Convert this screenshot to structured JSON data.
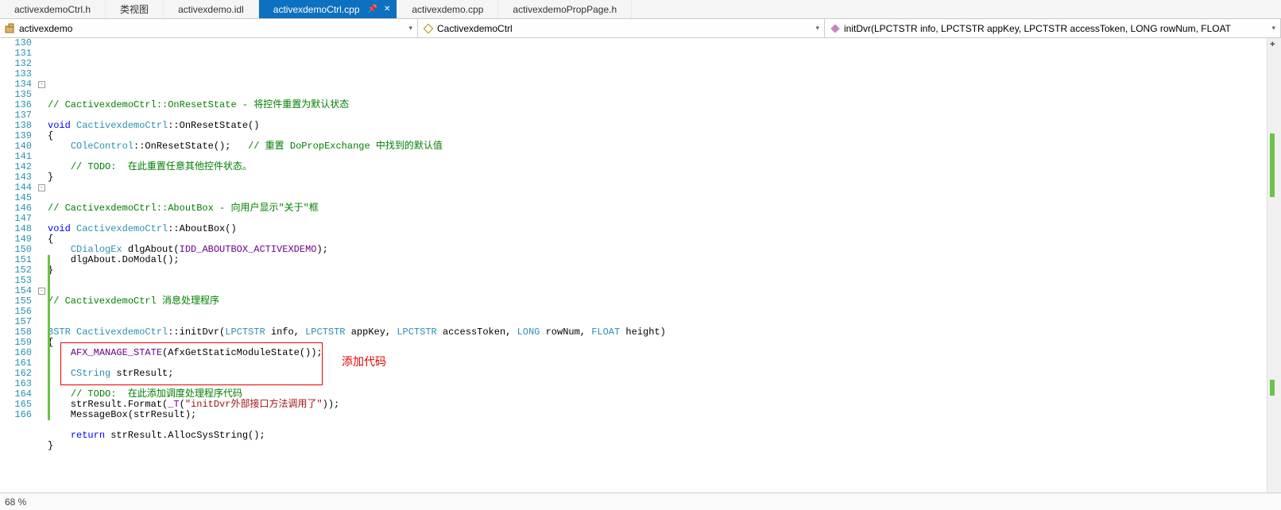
{
  "tabs": [
    {
      "label": "activexdemoCtrl.h"
    },
    {
      "label": "类视图"
    },
    {
      "label": "activexdemo.idl"
    },
    {
      "label": "activexdemoCtrl.cpp",
      "active": true
    },
    {
      "label": "activexdemo.cpp"
    },
    {
      "label": "activexdemoPropPage.h"
    }
  ],
  "activeTab": {
    "pinGlyph": "📌",
    "closeGlyph": "✕"
  },
  "nav": {
    "scope": "activexdemo",
    "cls": "CactivexdemoCtrl",
    "func": "initDvr(LPCTSTR info, LPCTSTR appKey, LPCTSTR accessToken, LONG rowNum, FLOAT"
  },
  "startLine": 130,
  "endLine": 166,
  "lines": [
    {
      "n": 130,
      "tokens": []
    },
    {
      "n": 131,
      "tokens": []
    },
    {
      "n": 132,
      "tokens": [
        [
          "comment",
          "// CactivexdemoCtrl::OnResetState - 将控件重置为默认状态"
        ]
      ]
    },
    {
      "n": 133,
      "tokens": []
    },
    {
      "n": 134,
      "outline": "-",
      "tokens": [
        [
          "keyword",
          "void "
        ],
        [
          "type",
          "CactivexdemoCtrl"
        ],
        [
          "plain",
          "::OnResetState()"
        ]
      ]
    },
    {
      "n": 135,
      "tokens": [
        [
          "plain",
          "{"
        ]
      ]
    },
    {
      "n": 136,
      "tokens": [
        [
          "plain",
          "    "
        ],
        [
          "type",
          "COleControl"
        ],
        [
          "plain",
          "::OnResetState();   "
        ],
        [
          "comment",
          "// 重置 DoPropExchange 中找到的默认值"
        ]
      ]
    },
    {
      "n": 137,
      "tokens": []
    },
    {
      "n": 138,
      "tokens": [
        [
          "plain",
          "    "
        ],
        [
          "comment",
          "// TODO:  在此重置任意其他控件状态。"
        ]
      ]
    },
    {
      "n": 139,
      "tokens": [
        [
          "plain",
          "}"
        ]
      ]
    },
    {
      "n": 140,
      "tokens": []
    },
    {
      "n": 141,
      "tokens": []
    },
    {
      "n": 142,
      "tokens": [
        [
          "comment",
          "// CactivexdemoCtrl::AboutBox - 向用户显示\"关于\"框"
        ]
      ]
    },
    {
      "n": 143,
      "tokens": []
    },
    {
      "n": 144,
      "outline": "-",
      "tokens": [
        [
          "keyword",
          "void "
        ],
        [
          "type",
          "CactivexdemoCtrl"
        ],
        [
          "plain",
          "::AboutBox()"
        ]
      ]
    },
    {
      "n": 145,
      "tokens": [
        [
          "plain",
          "{"
        ]
      ]
    },
    {
      "n": 146,
      "tokens": [
        [
          "plain",
          "    "
        ],
        [
          "type",
          "CDialogEx"
        ],
        [
          "plain",
          " dlgAbout("
        ],
        [
          "macro",
          "IDD_ABOUTBOX_ACTIVEXDEMO"
        ],
        [
          "plain",
          ");"
        ]
      ]
    },
    {
      "n": 147,
      "tokens": [
        [
          "plain",
          "    dlgAbout.DoModal();"
        ]
      ]
    },
    {
      "n": 148,
      "tokens": [
        [
          "plain",
          "}"
        ]
      ]
    },
    {
      "n": 149,
      "tokens": []
    },
    {
      "n": 150,
      "tokens": []
    },
    {
      "n": 151,
      "tokens": [
        [
          "comment",
          "// CactivexdemoCtrl 消息处理程序"
        ]
      ]
    },
    {
      "n": 152,
      "tokens": []
    },
    {
      "n": 153,
      "tokens": []
    },
    {
      "n": 154,
      "outline": "-",
      "tokens": [
        [
          "type",
          "BSTR CactivexdemoCtrl"
        ],
        [
          "plain",
          "::initDvr("
        ],
        [
          "type",
          "LPCTSTR"
        ],
        [
          "plain",
          " info, "
        ],
        [
          "type",
          "LPCTSTR"
        ],
        [
          "plain",
          " appKey, "
        ],
        [
          "type",
          "LPCTSTR"
        ],
        [
          "plain",
          " accessToken, "
        ],
        [
          "type",
          "LONG"
        ],
        [
          "plain",
          " rowNum, "
        ],
        [
          "type",
          "FLOAT"
        ],
        [
          "plain",
          " height)"
        ]
      ]
    },
    {
      "n": 155,
      "tokens": [
        [
          "plain",
          "{"
        ]
      ]
    },
    {
      "n": 156,
      "tokens": [
        [
          "plain",
          "    "
        ],
        [
          "macro",
          "AFX_MANAGE_STATE"
        ],
        [
          "plain",
          "(AfxGetStaticModuleState());"
        ]
      ]
    },
    {
      "n": 157,
      "tokens": []
    },
    {
      "n": 158,
      "tokens": [
        [
          "plain",
          "    "
        ],
        [
          "type",
          "CString"
        ],
        [
          "plain",
          " strResult;"
        ]
      ]
    },
    {
      "n": 159,
      "tokens": []
    },
    {
      "n": 160,
      "tokens": [
        [
          "plain",
          "    "
        ],
        [
          "comment",
          "// TODO:  在此添加调度处理程序代码"
        ]
      ]
    },
    {
      "n": 161,
      "tokens": [
        [
          "plain",
          "    strResult.Format("
        ],
        [
          "macro",
          "_T"
        ],
        [
          "plain",
          "("
        ],
        [
          "string",
          "\"initDvr外部接口方法调用了\""
        ],
        [
          "plain",
          "));"
        ]
      ]
    },
    {
      "n": 162,
      "tokens": [
        [
          "plain",
          "    MessageBox(strResult);"
        ]
      ]
    },
    {
      "n": 163,
      "tokens": []
    },
    {
      "n": 164,
      "tokens": [
        [
          "plain",
          "    "
        ],
        [
          "keyword",
          "return"
        ],
        [
          "plain",
          " strResult.AllocSysString();"
        ]
      ]
    },
    {
      "n": 165,
      "tokens": [
        [
          "plain",
          "}"
        ]
      ]
    },
    {
      "n": 166,
      "tokens": []
    }
  ],
  "annotation": "添加代码",
  "footer": {
    "zoom": "68 %"
  }
}
